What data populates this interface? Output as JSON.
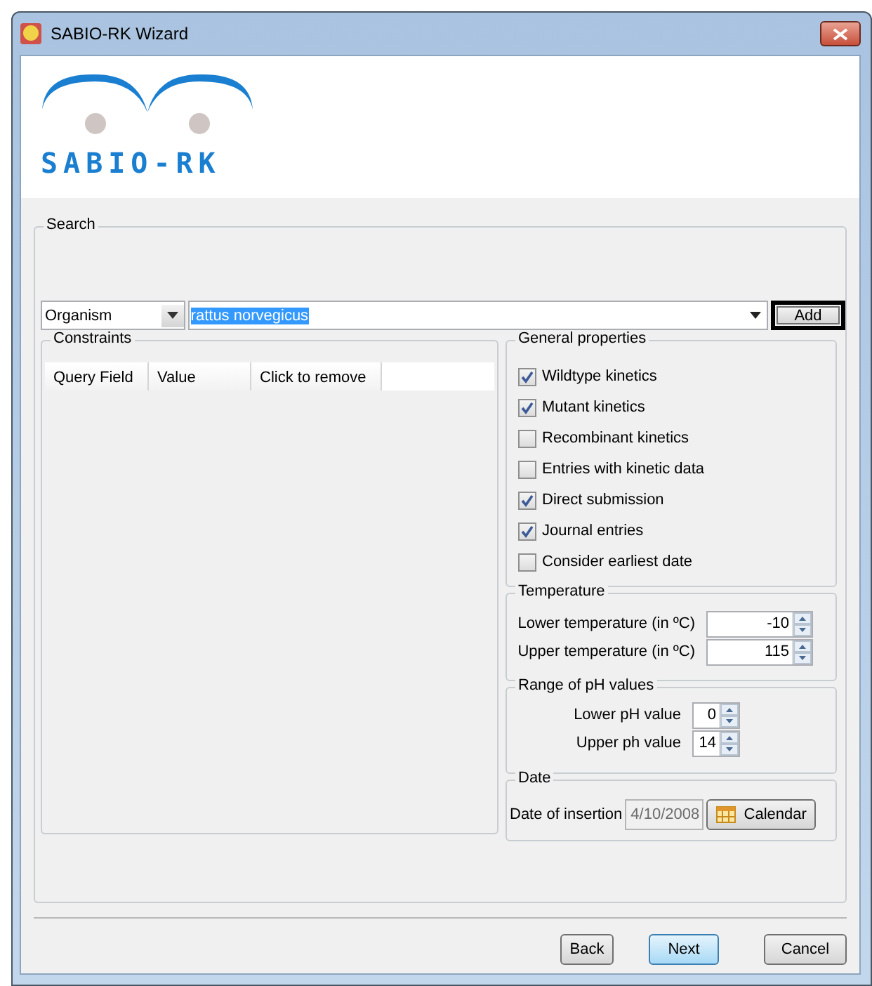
{
  "window": {
    "title": "SABIO-RK Wizard"
  },
  "logo": {
    "text": "SABIO-RK"
  },
  "search": {
    "title": "Search",
    "field_type": "Organism",
    "query": "rattus norvegicus",
    "query_selected": true,
    "add_button": "Add"
  },
  "constraints": {
    "title": "Constraints",
    "columns": [
      "Query Field",
      "Value",
      "Click to remove"
    ]
  },
  "general_properties": {
    "title": "General properties",
    "options": [
      {
        "label": "Wildtype kinetics",
        "checked": true
      },
      {
        "label": "Mutant kinetics",
        "checked": true
      },
      {
        "label": "Recombinant kinetics",
        "checked": false
      },
      {
        "label": "Entries with kinetic data",
        "checked": false
      },
      {
        "label": "Direct submission",
        "checked": true
      },
      {
        "label": "Journal entries",
        "checked": true
      },
      {
        "label": "Consider earliest date",
        "checked": false
      }
    ]
  },
  "temperature": {
    "title": "Temperature",
    "fields": [
      {
        "label": "Lower temperature (in ºC)",
        "value": "-10"
      },
      {
        "label": "Upper temperature (in ºC)",
        "value": "115"
      }
    ]
  },
  "ph": {
    "title": "Range of pH values",
    "fields": [
      {
        "label": "Lower pH value",
        "value": "0"
      },
      {
        "label": "Upper ph value",
        "value": "14"
      }
    ]
  },
  "date": {
    "title": "Date",
    "label": "Date of insertion",
    "value": "4/10/2008",
    "disabled": true,
    "button": "Calendar"
  },
  "buttons": [
    {
      "label": "Back",
      "default": false
    },
    {
      "label": "Next",
      "default": true
    },
    {
      "label": "Cancel",
      "default": false
    }
  ]
}
